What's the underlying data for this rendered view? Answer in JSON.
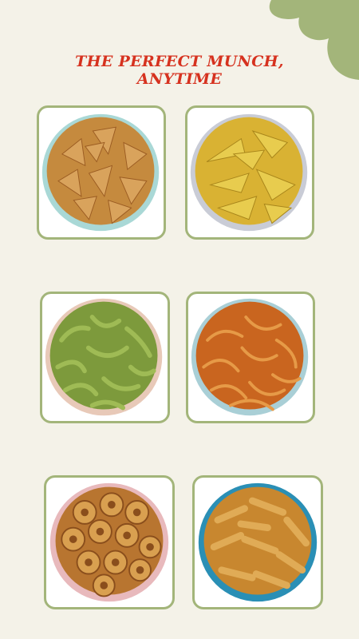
{
  "headline": {
    "line1": "THE PERFECT MUNCH,",
    "line2": "ANYTIME"
  },
  "colors": {
    "background": "#f4f2e8",
    "accent_blob": "#a3b57a",
    "headline": "#d6321f",
    "card_border": "#a3b57a"
  },
  "snacks": [
    {
      "icon": "triangle-chips-bowl-icon"
    },
    {
      "icon": "banana-chips-bowl-icon"
    },
    {
      "icon": "green-sticks-bowl-icon"
    },
    {
      "icon": "orange-sev-bowl-icon"
    },
    {
      "icon": "bhakarwadi-bowl-icon"
    },
    {
      "icon": "crunchy-sticks-bowl-icon"
    }
  ]
}
